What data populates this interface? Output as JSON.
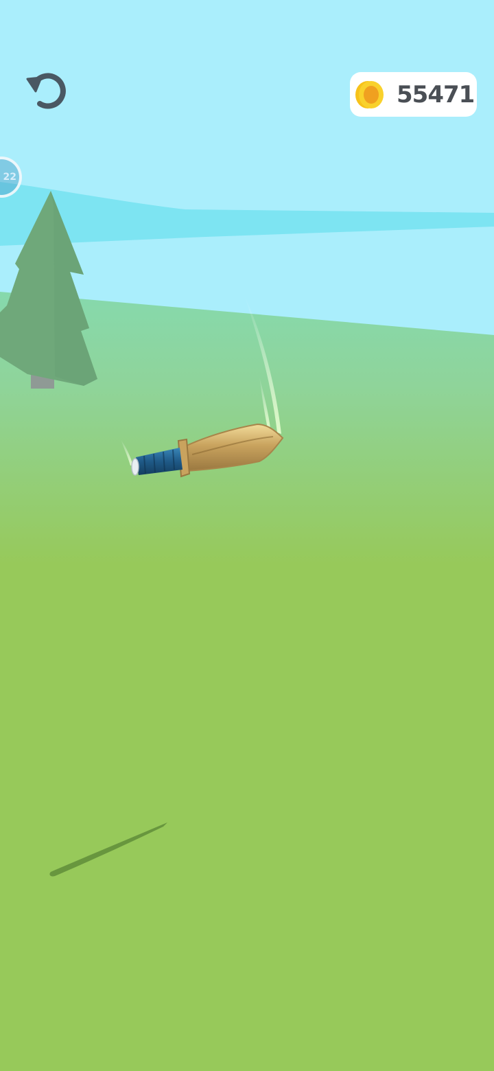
{
  "hud": {
    "restart_icon": "restart-arrow-icon",
    "coins": {
      "icon": "gold-coin-icon",
      "value": "55471"
    },
    "level_badge": {
      "text": "22"
    }
  },
  "scene": {
    "objects": [
      "pine-tree",
      "flying-knife",
      "knife-shadow",
      "motion-trails"
    ],
    "colors": {
      "sky": "#aaeefc",
      "water": "#7de4f2",
      "grass": "#97c95a",
      "tree": "#6fa87a",
      "blade": "#c9a35e",
      "handle": "#1f5a87"
    }
  }
}
